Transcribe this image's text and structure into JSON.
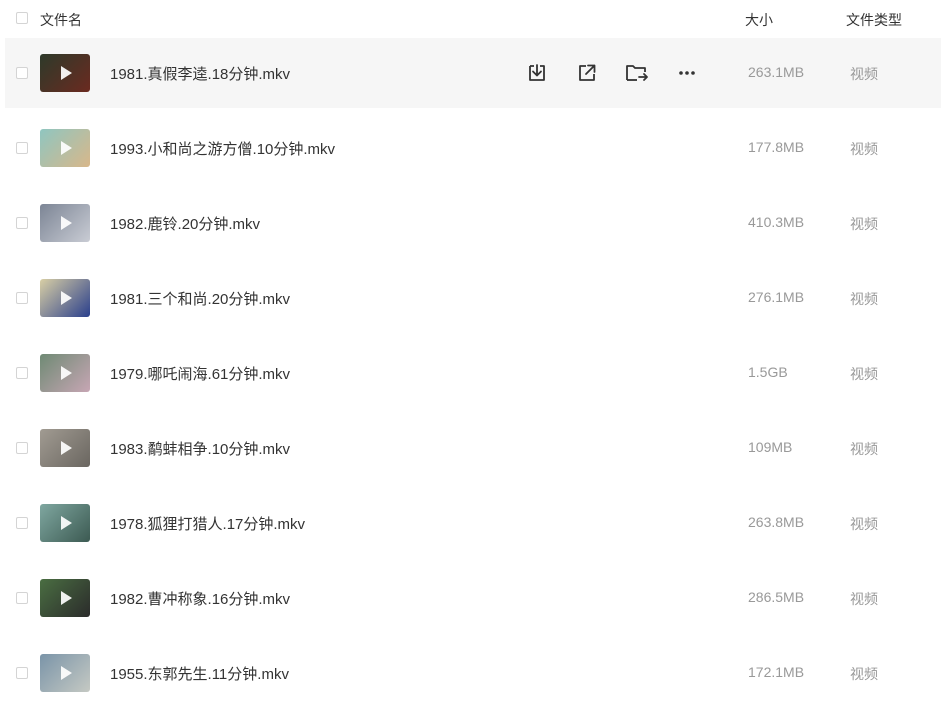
{
  "header": {
    "name_label": "文件名",
    "size_label": "大小",
    "type_label": "文件类型"
  },
  "actions": {
    "download_icon": "download-icon",
    "share_icon": "share-icon",
    "move_icon": "move-to-folder-icon",
    "more_icon": "more-icon"
  },
  "files": [
    {
      "name": "1981.真假李逵.18分钟.mkv",
      "size": "263.1MB",
      "type": "视频",
      "thumb_colors": [
        "#2d3a2a",
        "#6b2a20"
      ]
    },
    {
      "name": "1993.小和尚之游方僧.10分钟.mkv",
      "size": "177.8MB",
      "type": "视频",
      "thumb_colors": [
        "#8fc6c0",
        "#d8b78a"
      ]
    },
    {
      "name": "1982.鹿铃.20分钟.mkv",
      "size": "410.3MB",
      "type": "视频",
      "thumb_colors": [
        "#7c8595",
        "#c9ccd4"
      ]
    },
    {
      "name": "1981.三个和尚.20分钟.mkv",
      "size": "276.1MB",
      "type": "视频",
      "thumb_colors": [
        "#d9cfa5",
        "#2a3f8c"
      ]
    },
    {
      "name": "1979.哪吒闹海.61分钟.mkv",
      "size": "1.5GB",
      "type": "视频",
      "thumb_colors": [
        "#6f8a74",
        "#c7a6b4"
      ]
    },
    {
      "name": "1983.鹬蚌相争.10分钟.mkv",
      "size": "109MB",
      "type": "视频",
      "thumb_colors": [
        "#a19b92",
        "#6a6660"
      ]
    },
    {
      "name": "1978.狐狸打猎人.17分钟.mkv",
      "size": "263.8MB",
      "type": "视频",
      "thumb_colors": [
        "#7fa7a0",
        "#3c5a52"
      ]
    },
    {
      "name": "1982.曹冲称象.16分钟.mkv",
      "size": "286.5MB",
      "type": "视频",
      "thumb_colors": [
        "#4a6e42",
        "#2b2b2b"
      ]
    },
    {
      "name": "1955.东郭先生.11分钟.mkv",
      "size": "172.1MB",
      "type": "视频",
      "thumb_colors": [
        "#7a94a8",
        "#c5c9c3"
      ]
    }
  ]
}
